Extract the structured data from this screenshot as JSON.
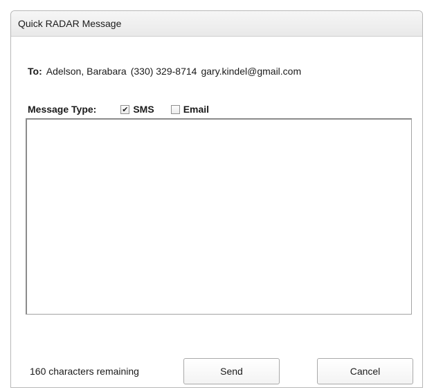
{
  "window": {
    "title": "Quick RADAR Message"
  },
  "recipient": {
    "label": "To:",
    "name": "Adelson, Barabara",
    "phone": "(330) 329-8714",
    "email": "gary.kindel@gmail.com"
  },
  "message_type": {
    "label": "Message Type:",
    "options": [
      {
        "label": "SMS",
        "checked": true,
        "mark": "✔"
      },
      {
        "label": "Email",
        "checked": false,
        "mark": ""
      }
    ]
  },
  "message": {
    "value": ""
  },
  "footer": {
    "characters_remaining": "160 characters remaining",
    "send_label": "Send",
    "cancel_label": "Cancel"
  }
}
